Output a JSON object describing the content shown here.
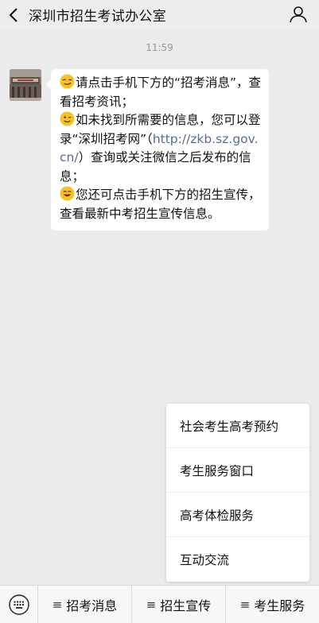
{
  "header": {
    "title": "深圳市招生考试办公室",
    "back_icon": "chevron-left-icon",
    "profile_icon": "person-icon"
  },
  "chat": {
    "timestamp": "11:59",
    "avatar_icon": "account-avatar",
    "message": {
      "line1_emoji": "smirk-emoji",
      "line1_text": "请点击手机下方的“招考消息”，查看招考资讯；",
      "line2_emoji": "wink-emoji",
      "line2_text_before": "如未找到所需要的信息，您可以登录“深圳招考网”（",
      "line2_link": "http://zkb.sz.gov.cn/",
      "line2_text_after": "）查询或关注微信之后发布的信息；",
      "line3_emoji": "grin-emoji",
      "line3_text": "您还可点击手机下方的招生宣传，查看最新中考招生宣传信息。"
    }
  },
  "popup_menu": {
    "items": [
      {
        "label": "社会考生高考预约"
      },
      {
        "label": "考生服务窗口"
      },
      {
        "label": "高考体检服务"
      },
      {
        "label": "互动交流"
      }
    ]
  },
  "menubar": {
    "keyboard_icon": "keyboard-icon",
    "items": [
      {
        "label": "招考消息"
      },
      {
        "label": "招生宣传"
      },
      {
        "label": "考生服务"
      }
    ],
    "menu_glyph": "≡"
  },
  "colors": {
    "background": "#ebebeb",
    "bubble": "#ffffff",
    "link": "#576b95",
    "header": "#ededed"
  }
}
